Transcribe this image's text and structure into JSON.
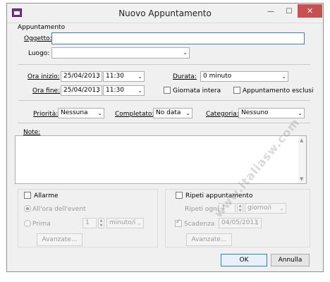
{
  "window": {
    "title": "Nuovo Appuntamento",
    "minimize": "—",
    "maximize": "☐",
    "close": "✕"
  },
  "appointment": {
    "section": "Appuntamento",
    "subject_label": "Oggetto:",
    "subject_value": "",
    "location_label": "Luogo:",
    "location_value": ""
  },
  "schedule": {
    "start_label": "Ora inizio:",
    "start_date": "25/04/2013",
    "start_time": "11:30",
    "end_label": "Ora fine:",
    "end_date": "25/04/2013",
    "end_time": "11:30",
    "duration_label": "Durata:",
    "duration_value": "0 minuto",
    "allday_label": "Giornata intera",
    "exclusive_label": "Appuntamento esclusi",
    "dropdown_glyph": "⌄"
  },
  "status": {
    "priority_label": "Priorità:",
    "priority_value": "Nessuna",
    "completed_label": "Completato:",
    "completed_value": "No data",
    "category_label": "Categoria:",
    "category_value": "Nessuno"
  },
  "notes": {
    "label": "Note:",
    "value": ""
  },
  "alarm": {
    "label": "Allarme",
    "on_event": "All'ora dell'event",
    "before": "Prima",
    "amount": "1",
    "unit": "minuto/i",
    "advanced": "Avanzate..."
  },
  "repeat": {
    "label": "Ripeti appuntamento",
    "every_label": "Ripeti ogni",
    "every_value": "1",
    "unit": "giorno/i",
    "expiry_label": "Scadenza",
    "expiry_date": "04/05/2013",
    "advanced": "Avanzate..."
  },
  "footer": {
    "ok": "OK",
    "cancel": "Annulla"
  },
  "watermark": "www.italiasw.com"
}
